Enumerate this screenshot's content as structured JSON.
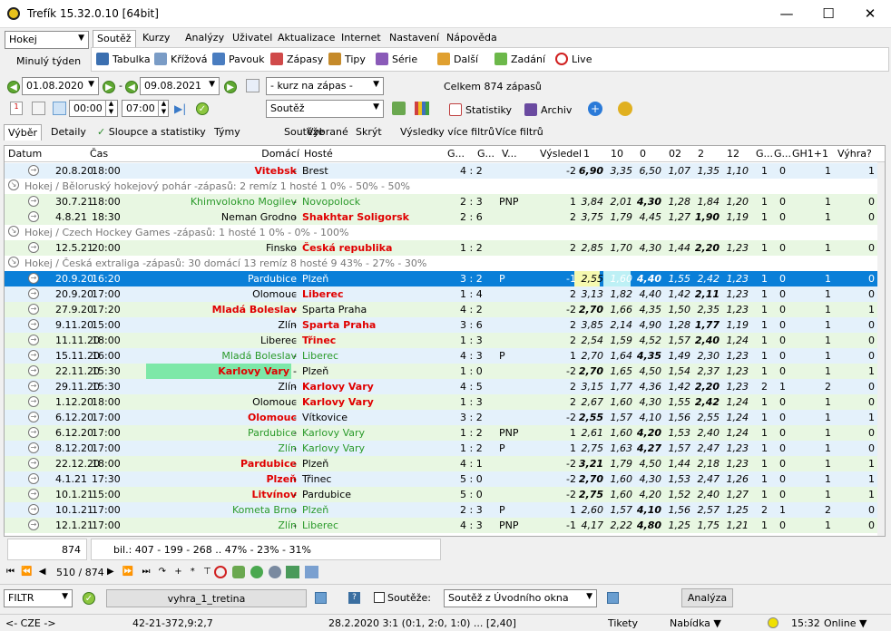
{
  "window": {
    "title": "Trefík 15.32.0.10 [64bit]",
    "min": "—",
    "max": "☐",
    "close": "✕"
  },
  "left": {
    "sport": "Hokej",
    "period": "Minulý týden"
  },
  "tabs": [
    "Soutěž",
    "Kurzy",
    "Analýzy",
    "Uživatel",
    "Aktualizace",
    "Internet",
    "Nastavení",
    "Nápověda"
  ],
  "toolbar": [
    "Tabulka",
    "Křížová",
    "Pavouk",
    "Zápasy",
    "Tipy",
    "Série",
    "Další",
    "Zadání",
    "Live"
  ],
  "filter": {
    "date_from": "01.08.2020",
    "dash": "-",
    "date_to": "09.08.2021",
    "kurz": "- kurz na zápas -",
    "total": "Celkem 874 zápasů",
    "time_from": "00:00",
    "time_to": "07:00",
    "souteze": "Soutěž",
    "stats": "Statistiky",
    "archiv": "Archiv",
    "cal": "1"
  },
  "subtabs": [
    "Výběr",
    "Detaily",
    "Sloupce a statistiky",
    "Týmy",
    "Soutěže",
    "Vybrané",
    "Skrýt",
    "Výsledky více filtrů",
    "Více filtrů"
  ],
  "columns": [
    "Datum",
    "Čas",
    "Domácí",
    "Hosté",
    "G...",
    "G...",
    "V...",
    "Výsledek",
    "1",
    "10",
    "0",
    "02",
    "2",
    "12",
    "G...",
    "G...",
    "GH1+1",
    "Výhra?"
  ],
  "groups": [
    {
      "text": "Hokej / Běloruský hokejový pohár -zápasů: 2   remíz 1  hosté 1       0% - 50% - 50%"
    },
    {
      "text": "Hokej / Czech Hockey Games -zápasů: 1      hosté 1      0% - 0% - 100%"
    },
    {
      "text": "Hokej / Česká extraliga -zápasů: 30  domácí 13  remíz 8  hosté 9      43% - 27% - 30%"
    }
  ],
  "rows": [
    {
      "d": "20.8.20",
      "t": "18:00",
      "h": "Vitebsk",
      "a": "Brest",
      "s": "4 : 2",
      "v": "",
      "r": "-2",
      "o": [
        "6,90",
        "3,35",
        "6,50",
        "1,07",
        "1,35",
        "1,10"
      ],
      "g": [
        "1",
        "0"
      ],
      "gh": "1",
      "w": "1"
    },
    {
      "d": "30.7.21",
      "t": "18:00",
      "h": "Khimvolokno Mogilev",
      "a": "Novopolock",
      "s": "2 : 3",
      "v": "PNP",
      "r": "1",
      "o": [
        "3,84",
        "2,01",
        "4,30",
        "1,28",
        "1,84",
        "1,20"
      ],
      "g": [
        "1",
        "0"
      ],
      "gh": "1",
      "w": "0"
    },
    {
      "d": "4.8.21",
      "t": "18:30",
      "h": "Neman Grodno",
      "a": "Shakhtar Soligorsk",
      "s": "2 : 6",
      "v": "",
      "r": "2",
      "o": [
        "3,75",
        "1,79",
        "4,45",
        "1,27",
        "1,90",
        "1,19"
      ],
      "g": [
        "1",
        "0"
      ],
      "gh": "1",
      "w": "0"
    },
    {
      "d": "12.5.21",
      "t": "20:00",
      "h": "Finsko",
      "a": "Česká republika",
      "s": "1 : 2",
      "v": "",
      "r": "2",
      "o": [
        "2,85",
        "1,70",
        "4,30",
        "1,44",
        "2,20",
        "1,23"
      ],
      "g": [
        "1",
        "0"
      ],
      "gh": "1",
      "w": "0"
    },
    {
      "d": "20.9.20",
      "t": "16:20",
      "h": "Pardubice",
      "a": "Plzeň",
      "s": "3 : 2",
      "v": "P",
      "r": "-1",
      "o": [
        "2,55",
        "1,60",
        "4,40",
        "1,55",
        "2,42",
        "1,23"
      ],
      "g": [
        "1",
        "0"
      ],
      "gh": "1",
      "w": "0"
    },
    {
      "d": "20.9.20",
      "t": "17:00",
      "h": "Olomouc",
      "a": "Liberec",
      "s": "1 : 4",
      "v": "",
      "r": "2",
      "o": [
        "3,13",
        "1,82",
        "4,40",
        "1,42",
        "2,11",
        "1,23"
      ],
      "g": [
        "1",
        "0"
      ],
      "gh": "1",
      "w": "0"
    },
    {
      "d": "27.9.20",
      "t": "17:20",
      "h": "Mladá Boleslav",
      "a": "Sparta Praha",
      "s": "4 : 2",
      "v": "",
      "r": "-2",
      "o": [
        "2,70",
        "1,66",
        "4,35",
        "1,50",
        "2,35",
        "1,23"
      ],
      "g": [
        "1",
        "0"
      ],
      "gh": "1",
      "w": "1"
    },
    {
      "d": "9.11.20",
      "t": "15:00",
      "h": "Zlín",
      "a": "Sparta Praha",
      "s": "3 : 6",
      "v": "",
      "r": "2",
      "o": [
        "3,85",
        "2,14",
        "4,90",
        "1,28",
        "1,77",
        "1,19"
      ],
      "g": [
        "1",
        "0"
      ],
      "gh": "1",
      "w": "0"
    },
    {
      "d": "11.11.20",
      "t": "18:00",
      "h": "Liberec",
      "a": "Třinec",
      "s": "1 : 3",
      "v": "",
      "r": "2",
      "o": [
        "2,54",
        "1,59",
        "4,52",
        "1,57",
        "2,40",
        "1,24"
      ],
      "g": [
        "1",
        "0"
      ],
      "gh": "1",
      "w": "0"
    },
    {
      "d": "15.11.20",
      "t": "16:00",
      "h": "Mladá Boleslav",
      "a": "Liberec",
      "s": "4 : 3",
      "v": "P",
      "r": "1",
      "o": [
        "2,70",
        "1,64",
        "4,35",
        "1,49",
        "2,30",
        "1,23"
      ],
      "g": [
        "1",
        "0"
      ],
      "gh": "1",
      "w": "0"
    },
    {
      "d": "22.11.20",
      "t": "15:30",
      "h": "Karlovy Vary",
      "a": "Plzeň",
      "s": "1 : 0",
      "v": "",
      "r": "-2",
      "o": [
        "2,70",
        "1,65",
        "4,50",
        "1,54",
        "2,37",
        "1,23"
      ],
      "g": [
        "1",
        "0"
      ],
      "gh": "1",
      "w": "1"
    },
    {
      "d": "29.11.20",
      "t": "15:30",
      "h": "Zlín",
      "a": "Karlovy Vary",
      "s": "4 : 5",
      "v": "",
      "r": "2",
      "o": [
        "3,15",
        "1,77",
        "4,36",
        "1,42",
        "2,20",
        "1,23"
      ],
      "g": [
        "2",
        "1"
      ],
      "gh": "2",
      "w": "0"
    },
    {
      "d": "1.12.20",
      "t": "18:00",
      "h": "Olomouc",
      "a": "Karlovy Vary",
      "s": "1 : 3",
      "v": "",
      "r": "2",
      "o": [
        "2,67",
        "1,60",
        "4,30",
        "1,55",
        "2,42",
        "1,24"
      ],
      "g": [
        "1",
        "0"
      ],
      "gh": "1",
      "w": "0"
    },
    {
      "d": "6.12.20",
      "t": "17:00",
      "h": "Olomouc",
      "a": "Vítkovice",
      "s": "3 : 2",
      "v": "",
      "r": "-2",
      "o": [
        "2,55",
        "1,57",
        "4,10",
        "1,56",
        "2,55",
        "1,24"
      ],
      "g": [
        "1",
        "0"
      ],
      "gh": "1",
      "w": "1"
    },
    {
      "d": "6.12.20",
      "t": "17:00",
      "h": "Pardubice",
      "a": "Karlovy Vary",
      "s": "1 : 2",
      "v": "PNP",
      "r": "1",
      "o": [
        "2,61",
        "1,60",
        "4,20",
        "1,53",
        "2,40",
        "1,24"
      ],
      "g": [
        "1",
        "0"
      ],
      "gh": "1",
      "w": "0"
    },
    {
      "d": "8.12.20",
      "t": "17:00",
      "h": "Zlín",
      "a": "Karlovy Vary",
      "s": "1 : 2",
      "v": "P",
      "r": "1",
      "o": [
        "2,75",
        "1,63",
        "4,27",
        "1,57",
        "2,47",
        "1,23"
      ],
      "g": [
        "1",
        "0"
      ],
      "gh": "1",
      "w": "0"
    },
    {
      "d": "22.12.20",
      "t": "18:00",
      "h": "Pardubice",
      "a": "Plzeň",
      "s": "4 : 1",
      "v": "",
      "r": "-2",
      "o": [
        "3,21",
        "1,79",
        "4,50",
        "1,44",
        "2,18",
        "1,23"
      ],
      "g": [
        "1",
        "0"
      ],
      "gh": "1",
      "w": "1"
    },
    {
      "d": "4.1.21",
      "t": "17:30",
      "h": "Plzeň",
      "a": "Třinec",
      "s": "5 : 0",
      "v": "",
      "r": "-2",
      "o": [
        "2,70",
        "1,60",
        "4,30",
        "1,53",
        "2,47",
        "1,26"
      ],
      "g": [
        "1",
        "0"
      ],
      "gh": "1",
      "w": "1"
    },
    {
      "d": "10.1.21",
      "t": "15:00",
      "h": "Litvínov",
      "a": "Pardubice",
      "s": "5 : 0",
      "v": "",
      "r": "-2",
      "o": [
        "2,75",
        "1,60",
        "4,20",
        "1,52",
        "2,40",
        "1,27"
      ],
      "g": [
        "1",
        "0"
      ],
      "gh": "1",
      "w": "1"
    },
    {
      "d": "10.1.21",
      "t": "17:00",
      "h": "Kometa Brno",
      "a": "Plzeň",
      "s": "2 : 3",
      "v": "P",
      "r": "1",
      "o": [
        "2,60",
        "1,57",
        "4,10",
        "1,56",
        "2,57",
        "1,25"
      ],
      "g": [
        "2",
        "1"
      ],
      "gh": "2",
      "w": "0"
    },
    {
      "d": "12.1.21",
      "t": "17:00",
      "h": "Zlín",
      "a": "Liberec",
      "s": "4 : 3",
      "v": "PNP",
      "r": "-1",
      "o": [
        "4,17",
        "2,22",
        "4,80",
        "1,25",
        "1,75",
        "1,21"
      ],
      "g": [
        "1",
        "0"
      ],
      "gh": "1",
      "w": "0"
    }
  ],
  "summary": {
    "count": "874",
    "bil": "bil.: 407 - 199 - 268 .. 47% - 23% - 31%"
  },
  "nav": {
    "pos": "510 / 874"
  },
  "bottom": {
    "filtr": "FILTR",
    "name": "vyhra_1_tretina",
    "q": "?",
    "souteze_label": "Soutěže:",
    "souteze_val": "Soutěž z Úvodního okna",
    "analyza": "Analýza"
  },
  "status": {
    "lang": "<- CZE ->",
    "s1": "42-21-37",
    "s2": "2,9:2,7",
    "match": "28.2.2020 3:1 (0:1, 2:0, 1:0) ... [2,40]",
    "tikety": "Tikety",
    "nabidka": "Nabídka ▼",
    "time": "15:32",
    "online": "Online ▼"
  }
}
